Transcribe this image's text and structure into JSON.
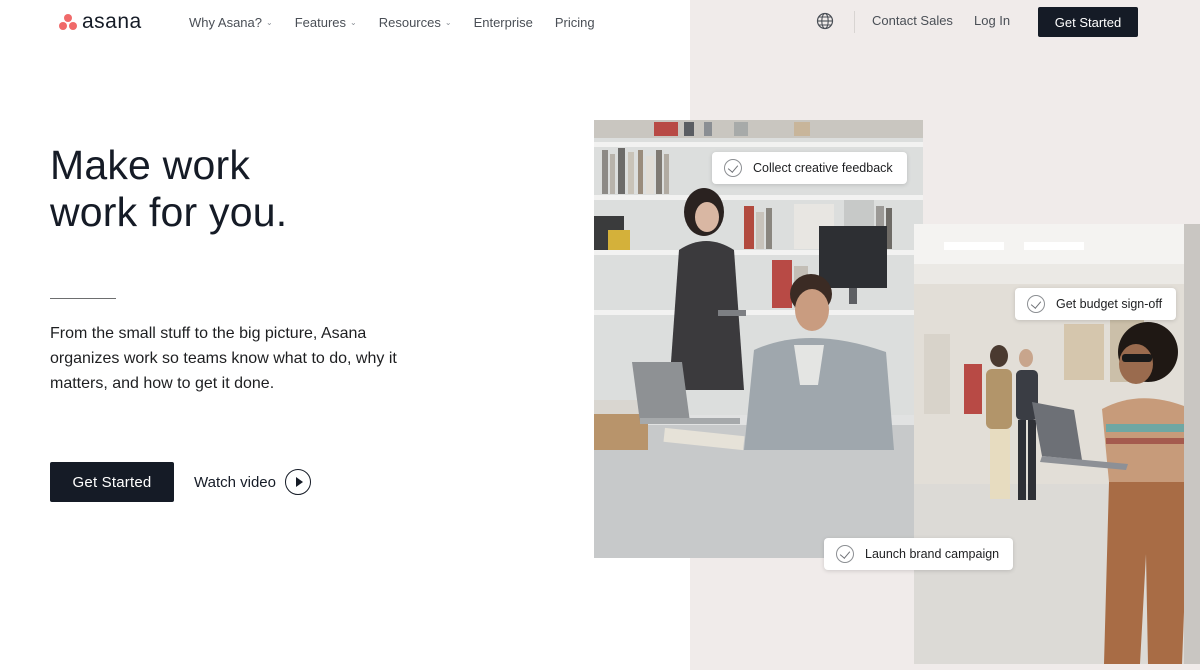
{
  "header": {
    "logo_text": "asana",
    "nav": [
      {
        "label": "Why Asana?",
        "has_dropdown": true
      },
      {
        "label": "Features",
        "has_dropdown": true
      },
      {
        "label": "Resources",
        "has_dropdown": true
      },
      {
        "label": "Enterprise",
        "has_dropdown": false
      },
      {
        "label": "Pricing",
        "has_dropdown": false
      }
    ],
    "language_icon": "globe-icon",
    "contact_sales": "Contact Sales",
    "log_in": "Log In",
    "get_started": "Get Started"
  },
  "hero": {
    "headline_line1": "Make work",
    "headline_line2": "work for you.",
    "subtext": "From the small stuff to the big picture, Asana organizes work so teams know what to do, why it matters, and how to get it done.",
    "cta_primary": "Get Started",
    "cta_secondary": "Watch video"
  },
  "tasks": {
    "task_1": "Collect creative feedback",
    "task_2": "Get budget sign-off",
    "task_3": "Launch brand campaign"
  },
  "colors": {
    "brand_coral": "#f06a6a",
    "ink": "#151b26",
    "panel_bg": "#f0ebea"
  }
}
